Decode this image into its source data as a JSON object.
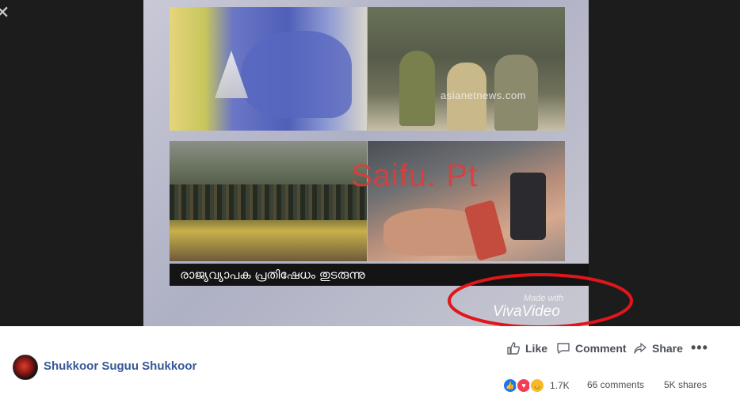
{
  "video": {
    "watermark_top_right": "asianetnews.com",
    "overlay_text": "Saifu. Pt",
    "caption": "രാജ്യവ്യാപക പ്രതിഷേധം തുടരുന്നു",
    "made_with": "Made with",
    "brand": "VivaVideo",
    "highlight_color": "#e0161b"
  },
  "actions": {
    "like": "Like",
    "comment": "Comment",
    "share": "Share",
    "more": "•••"
  },
  "page": {
    "name": "Shukkoor Suguu Shukkoor"
  },
  "stats": {
    "reactions": "1.7K",
    "comments": "66 comments",
    "shares": "5K shares"
  }
}
